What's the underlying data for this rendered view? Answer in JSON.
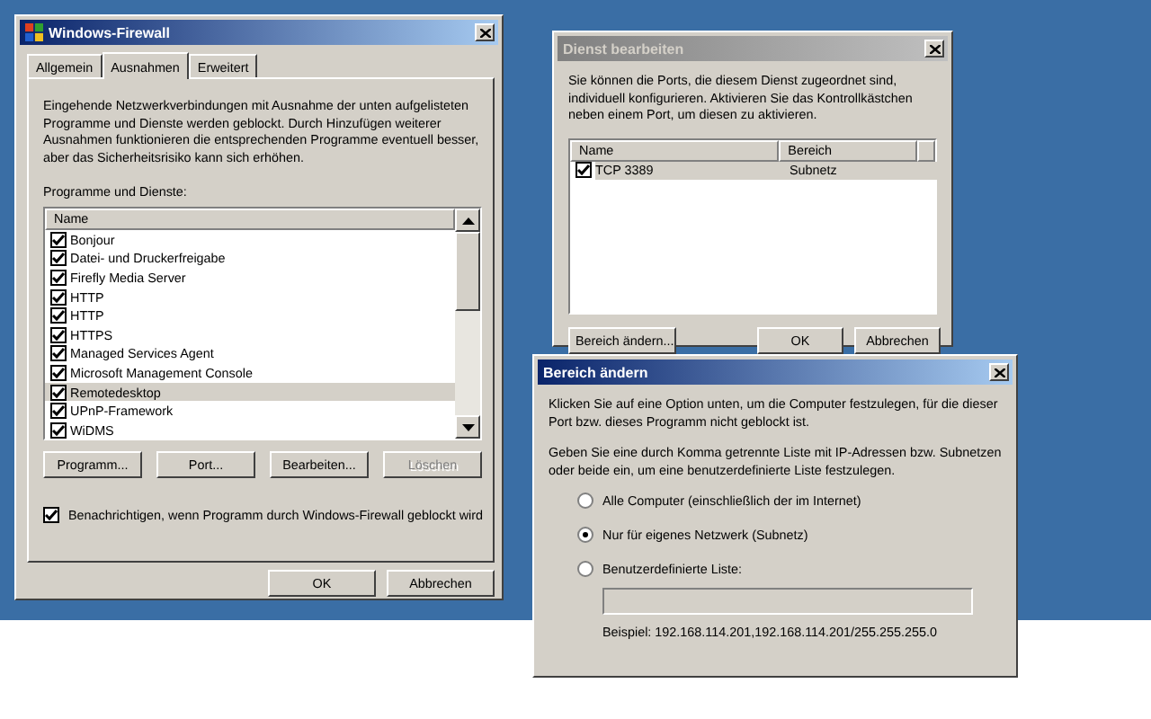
{
  "firewall_window": {
    "title": "Windows-Firewall",
    "active": true,
    "tabs": [
      {
        "label": "Allgemein",
        "selected": false
      },
      {
        "label": "Ausnahmen",
        "selected": true
      },
      {
        "label": "Erweitert",
        "selected": false
      }
    ],
    "description": "Eingehende Netzwerkverbindungen mit Ausnahme der unten aufgelisteten Programme und Dienste werden geblockt. Durch Hinzufügen weiterer Ausnahmen funktionieren die entsprechenden Programme eventuell besser, aber das Sicherheitsrisiko kann sich erhöhen.",
    "list_label": "Programme und Dienste:",
    "list_columns": [
      "Name"
    ],
    "items": [
      {
        "label": "Bonjour",
        "checked": true,
        "selected": false
      },
      {
        "label": "Datei- und Druckerfreigabe",
        "checked": true,
        "selected": false
      },
      {
        "label": "Firefly Media Server",
        "checked": true,
        "selected": false
      },
      {
        "label": "HTTP",
        "checked": true,
        "selected": false
      },
      {
        "label": "HTTP",
        "checked": true,
        "selected": false
      },
      {
        "label": "HTTPS",
        "checked": true,
        "selected": false
      },
      {
        "label": "Managed Services Agent",
        "checked": true,
        "selected": false
      },
      {
        "label": "Microsoft Management Console",
        "checked": true,
        "selected": false
      },
      {
        "label": "Remotedesktop",
        "checked": true,
        "selected": true
      },
      {
        "label": "UPnP-Framework",
        "checked": true,
        "selected": false
      },
      {
        "label": "WiDMS",
        "checked": true,
        "selected": false
      }
    ],
    "buttons": [
      {
        "label": "Programm...",
        "disabled": false
      },
      {
        "label": "Port...",
        "disabled": false
      },
      {
        "label": "Bearbeiten...",
        "disabled": false
      },
      {
        "label": "Löschen",
        "disabled": true
      }
    ],
    "notify": {
      "label": "Benachrichtigen, wenn Programm durch Windows-Firewall geblockt wird",
      "checked": true
    },
    "footer_buttons": [
      "OK",
      "Abbrechen"
    ]
  },
  "service_dialog": {
    "title": "Dienst bearbeiten",
    "active": false,
    "description": "Sie können die Ports, die diesem Dienst zugeordnet sind, individuell konfigurieren. Aktivieren Sie das Kontrollkästchen neben einem Port, um diesen zu aktivieren.",
    "columns": [
      "Name",
      "Bereich"
    ],
    "rows": [
      {
        "name": "TCP 3389",
        "scope": "Subnetz",
        "checked": true,
        "selected": true
      }
    ],
    "left_button": "Bereich ändern...",
    "footer_buttons": [
      "OK",
      "Abbrechen"
    ]
  },
  "scope_dialog": {
    "title": "Bereich ändern",
    "active": true,
    "text_1": "Klicken Sie auf eine Option unten, um die Computer festzulegen, für die dieser Port bzw. dieses Programm nicht geblockt ist.",
    "text_2": "Geben Sie eine durch Komma getrennte Liste mit IP-Adressen bzw. Subnetzen oder beide ein, um eine benutzerdefinierte Liste festzulegen.",
    "options": [
      {
        "label": "Alle Computer (einschließlich der im Internet)",
        "selected": false
      },
      {
        "label": "Nur für eigenes Netzwerk (Subnetz)",
        "selected": true
      },
      {
        "label": "Benutzerdefinierte Liste:",
        "selected": false
      }
    ],
    "custom_list_disabled": true,
    "example": "Beispiel: 192.168.114.201,192.168.114.201/255.255.255.0"
  }
}
